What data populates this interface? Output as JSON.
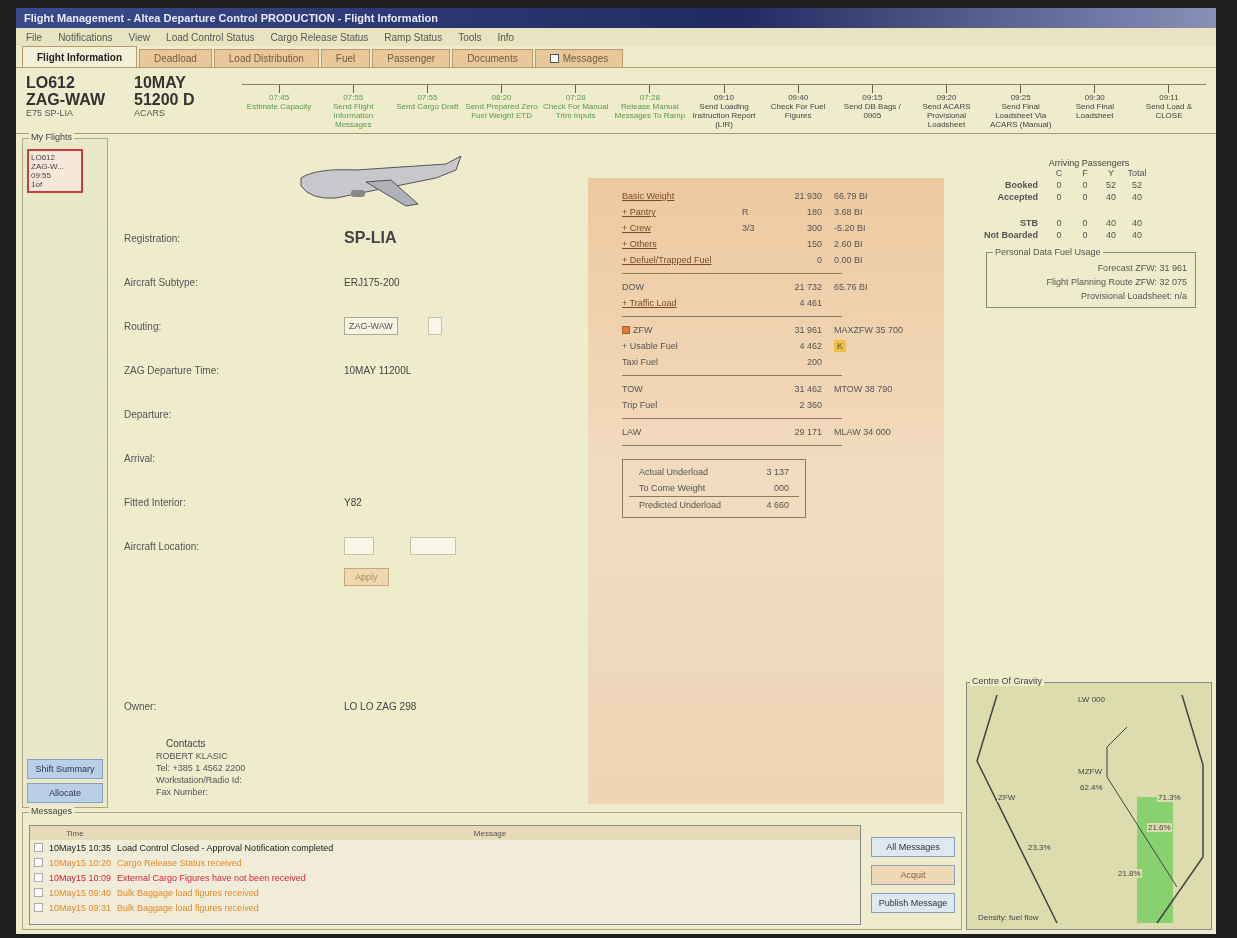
{
  "window": {
    "title": "Flight Management - Altea Departure Control PRODUCTION - Flight Information"
  },
  "menu": [
    "File",
    "Notifications",
    "View",
    "Load Control Status",
    "Cargo Release Status",
    "Ramp Status",
    "Tools",
    "Info"
  ],
  "tabs": [
    {
      "label": "Flight Information",
      "selected": true,
      "kind": "plain"
    },
    {
      "label": "Deadload",
      "selected": false,
      "kind": "plain"
    },
    {
      "label": "Load Distribution",
      "selected": false,
      "kind": "plain"
    },
    {
      "label": "Fuel",
      "selected": false,
      "kind": "plain"
    },
    {
      "label": "Passenger",
      "selected": false,
      "kind": "plain"
    },
    {
      "label": "Documents",
      "selected": false,
      "kind": "plain"
    },
    {
      "label": "Messages",
      "selected": false,
      "kind": "checkbox"
    }
  ],
  "flight": {
    "number": "LO612",
    "route": "ZAG-WAW",
    "aircraft": "E75 SP-LIA",
    "date": "10MAY",
    "time": "51200 D",
    "status": "ACARS"
  },
  "milestones": [
    {
      "time": "07:45",
      "label": "Estimate Capacity",
      "done": true
    },
    {
      "time": "07:55",
      "label": "Send Flight Information Messages",
      "done": true
    },
    {
      "time": "07:55",
      "label": "Send Cargo Draft",
      "done": true
    },
    {
      "time": "08:20",
      "label": "Send Prepared Zero Fuel Weight ETD",
      "done": true
    },
    {
      "time": "07:28",
      "label": "Check For Manual Trim Inputs",
      "done": true
    },
    {
      "time": "07:28",
      "label": "Release Manual Messages To Ramp",
      "done": true
    },
    {
      "time": "09:10",
      "label": "Send Loading Instruction Report (LIR)",
      "done": false
    },
    {
      "time": "09:40",
      "label": "Check For Fuel Figures",
      "done": false
    },
    {
      "time": "09:15",
      "label": "Send DB Bags / 0905",
      "done": false
    },
    {
      "time": "09:20",
      "label": "Send ACARS Provisional Loadsheet",
      "done": false
    },
    {
      "time": "09:25",
      "label": "Send Final Loadsheet Via ACARS (Manual)",
      "done": false
    },
    {
      "time": "09:30",
      "label": "Send Final Loadsheet",
      "done": false
    },
    {
      "time": "09:11",
      "label": "Send Load & CLOSE",
      "done": false
    }
  ],
  "my_flights": {
    "title": "My Flights",
    "items": [
      {
        "lines": [
          "LO612",
          "ZAG-W...",
          "09:55",
          "1of"
        ],
        "selected": true
      }
    ],
    "buttons": [
      "Shift Summary",
      "Allocate"
    ]
  },
  "details": [
    {
      "label": "Registration:",
      "value": "SP-LIA",
      "kind": "big"
    },
    {
      "label": "Aircraft Subtype:",
      "value": "ERJ175-200",
      "kind": "text"
    },
    {
      "label": "Routing:",
      "value": "ZAG-WAW",
      "kind": "field"
    },
    {
      "label": "ZAG Departure Time:",
      "value": "10MAY 11200L",
      "kind": "text"
    },
    {
      "label": "Departure:",
      "kind": "text"
    },
    {
      "label": "Arrival:",
      "kind": "text"
    },
    {
      "label": "Fitted Interior:",
      "value": "Y82",
      "kind": "text"
    },
    {
      "label": "Aircraft Location:",
      "kind": "location"
    }
  ],
  "apply_button": "Apply",
  "owner": {
    "label": "Owner:",
    "value": "LO LO ZAG 298"
  },
  "contacts": {
    "title": "Contacts",
    "lines": [
      "ROBERT KLASIC",
      "Tel: +385 1 4562 2200",
      "Workstation/Radio Id:",
      "Fax Number:"
    ]
  },
  "weights": [
    {
      "kind": "link",
      "label": "Basic Weight",
      "value": "21 930",
      "index": "66.79 BI"
    },
    {
      "kind": "link",
      "label": "+ Pantry",
      "code": "R",
      "value": "180",
      "index": "3.68 BI"
    },
    {
      "kind": "link",
      "label": "+ Crew",
      "code": "3/3",
      "value": "300",
      "index": "-5.20 BI"
    },
    {
      "kind": "link",
      "label": "+ Others",
      "value": "150",
      "index": "2.60 BI"
    },
    {
      "kind": "link",
      "label": "+ Defuel/Trapped Fuel",
      "value": "0",
      "index": "0.00 BI"
    },
    {
      "kind": "rule"
    },
    {
      "kind": "plain",
      "label": "DOW",
      "value": "21 732",
      "index": "65.76 BI"
    },
    {
      "kind": "link",
      "label": "+ Traffic Load",
      "value": "4 461"
    },
    {
      "kind": "rule"
    },
    {
      "kind": "check",
      "label": "ZFW",
      "value": "31 961",
      "index": "MAXZFW 35 700",
      "checked": true
    },
    {
      "kind": "flag",
      "label": "+ Usable Fuel",
      "value": "4 462",
      "flag": "K"
    },
    {
      "kind": "plain",
      "label": "Taxi Fuel",
      "value": "200"
    },
    {
      "kind": "rule"
    },
    {
      "kind": "plain",
      "label": "TOW",
      "value": "31 462",
      "index": "MTOW 38 790"
    },
    {
      "kind": "plain",
      "label": "Trip Fuel",
      "value": "2 360"
    },
    {
      "kind": "rule"
    },
    {
      "kind": "plain",
      "label": "LAW",
      "value": "29 171",
      "index": "MLAW 34 000"
    }
  ],
  "underload": [
    {
      "label": "Actual Underload",
      "value": "3 137"
    },
    {
      "label": "To Come Weight",
      "value": "000"
    },
    {
      "label": "Predicted Underload",
      "value": "4 660"
    }
  ],
  "passengers": {
    "title": "Arriving Passengers",
    "columns": [
      "C",
      "F",
      "Y",
      "Total"
    ],
    "rows": [
      {
        "label": "Booked",
        "values": [
          "0",
          "0",
          "52",
          "52"
        ]
      },
      {
        "label": "Accepted",
        "values": [
          "0",
          "0",
          "40",
          "40"
        ]
      },
      {
        "label": "STB",
        "values": [
          "0",
          "0",
          "40",
          "40"
        ]
      },
      {
        "label": "Not Boarded",
        "values": [
          "0",
          "0",
          "40",
          "40"
        ]
      }
    ]
  },
  "fuel_usage": {
    "title": "Personal Data Fuel Usage",
    "lines": [
      "Forecast ZFW: 31 961",
      "Flight Planning Route ZFW: 32 075",
      "Provisional Loadsheet: n/a"
    ]
  },
  "cg": {
    "title": "Centre Of Gravity",
    "labels": [
      "LW 000",
      "ZFW",
      "MZFW",
      "62.4%",
      "21.8%",
      "23.3%",
      "21.6%",
      "71.3%",
      "Density: fuel flow"
    ]
  },
  "messages": {
    "title": "Messages",
    "columns": [
      "Time",
      "Message"
    ],
    "rows": [
      {
        "time": "10May15 10:35",
        "text": "Load Control Closed - Approval Notification completed",
        "kind": "info",
        "checked": false
      },
      {
        "time": "10May15 10:20",
        "text": "Cargo Release Status received",
        "kind": "warning",
        "checked": false
      },
      {
        "time": "10May15 10:09",
        "text": "External Cargo Figures have not been received",
        "kind": "alert",
        "checked": false
      },
      {
        "time": "10May15 09:40",
        "text": "Bulk Baggage load figures received",
        "kind": "warning",
        "checked": false
      },
      {
        "time": "10May15 09:31",
        "text": "Bulk Baggage load figures received",
        "kind": "warning",
        "checked": false
      }
    ],
    "buttons": [
      {
        "label": "All Messages",
        "disabled": false
      },
      {
        "label": "Acquit",
        "disabled": true
      },
      {
        "label": "Publish Message",
        "disabled": false
      }
    ]
  }
}
